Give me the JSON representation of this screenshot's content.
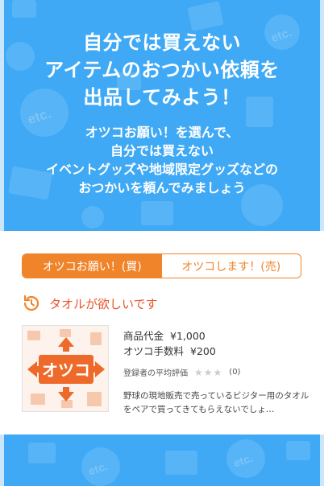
{
  "hero": {
    "title_lines": [
      "自分では買えない",
      "アイテムのおつかい依頼を",
      "出品してみよう！"
    ],
    "subtitle_lines": [
      "オツコお願い！を選んで、",
      "自分では買えない",
      "イベントグッズや地域限定グッズなどの",
      "おつかいを頼んでみましょう"
    ],
    "pattern_text": "etc."
  },
  "tabs": [
    {
      "label": "オツコお願い！(買)",
      "active": true
    },
    {
      "label": "オツコします！(売)",
      "active": false
    }
  ],
  "listing": {
    "title": "タオルが欲しいです",
    "thumb_label": "オツコ",
    "price_label": "商品代金",
    "price_value": "¥1,000",
    "fee_label": "オツコ手数料",
    "fee_value": "¥200",
    "rating_label": "登録者の平均評価",
    "rating_stars": 0,
    "rating_count": "(0)",
    "description": "野球の現地販売で売っているビジター用のタオルをペアで買ってきてもらえないでしょ…"
  },
  "colors": {
    "hero_bg": "#3fa9f5",
    "accent": "#f0842a",
    "title_red": "#e8542a"
  }
}
